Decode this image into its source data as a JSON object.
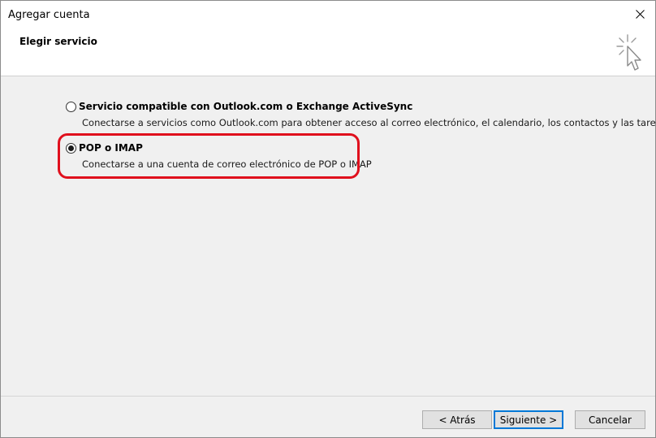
{
  "window": {
    "title": "Agregar cuenta"
  },
  "header": {
    "title": "Elegir servicio"
  },
  "options": [
    {
      "label": "Servicio compatible con Outlook.com o Exchange ActiveSync",
      "description": "Conectarse a servicios como Outlook.com para obtener acceso al correo electrónico, el calendario, los contactos y las tareas",
      "selected": false
    },
    {
      "label": "POP o IMAP",
      "description": "Conectarse a una cuenta de correo electrónico de POP o IMAP",
      "selected": true
    }
  ],
  "buttons": {
    "back": "< Atrás",
    "next": "Siguiente >",
    "cancel": "Cancelar"
  },
  "colors": {
    "highlight": "#e0101d",
    "default_button_border": "#0078d7"
  },
  "icons": {
    "close": "close-icon",
    "wizard": "wizard-cursor-icon"
  }
}
